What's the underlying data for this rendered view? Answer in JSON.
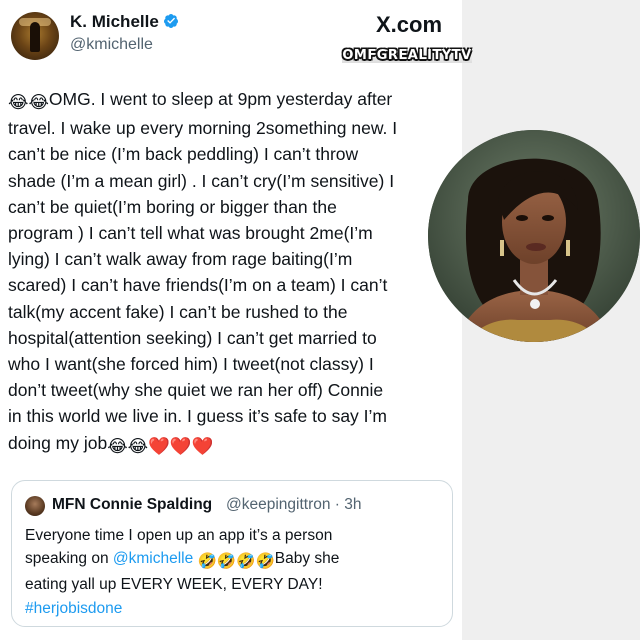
{
  "author": {
    "name": "K. Michelle",
    "handle": "@kmichelle"
  },
  "branding": {
    "site": "X.com",
    "watermark": "OMFGREALITYTV"
  },
  "tweet": {
    "lines": [
      {
        "prefix_emoji": "😂😂",
        "text": "OMG. I went to sleep at 9pm yesterday after"
      },
      {
        "text": "travel. I wake up every morning 2something new. I"
      },
      {
        "text": "can’t be nice (I’m back peddling) I can’t throw"
      },
      {
        "text": "shade (I’m a mean girl) . I can’t cry(I’m sensitive) I"
      },
      {
        "text": "can’t be quiet(I’m boring or bigger than the"
      },
      {
        "text": "program ) I can’t tell what was brought 2me(I’m"
      },
      {
        "text": "lying) I can’t walk away from rage baiting(I’m"
      },
      {
        "text": "scared) I can’t have friends(I’m on a team) I can’t"
      },
      {
        "text": "talk(my accent fake) I can’t be rushed to the"
      },
      {
        "text": "hospital(attention seeking) I can’t get married to"
      },
      {
        "text": "who I want(she forced him) I tweet(not classy) I"
      },
      {
        "text": "don’t tweet(why she quiet we ran her off) Connie"
      },
      {
        "text": "in this world we live in. I guess it’s safe to say I’m"
      },
      {
        "text": "doing my job",
        "suffix_emoji": "😂😂❤️❤️❤️"
      }
    ]
  },
  "quote": {
    "name": "MFN Connie Spalding",
    "handle_time": "@keepingittron · 3h",
    "line1": "Everyone time I open up an app it’s a person",
    "line2_prefix": "speaking on ",
    "line2_mention": "@kmichelle",
    "line2_emoji": "🤣🤣🤣🤣",
    "line2_suffix": "Baby she",
    "line3": "eating yall up EVERY WEEK, EVERY DAY!",
    "hashtag": "#herjobisdone"
  },
  "colors": {
    "verified": "#1d9bf0",
    "link": "#1d9bf0",
    "secondary_text": "#536471",
    "right_panel": "#efefef"
  }
}
